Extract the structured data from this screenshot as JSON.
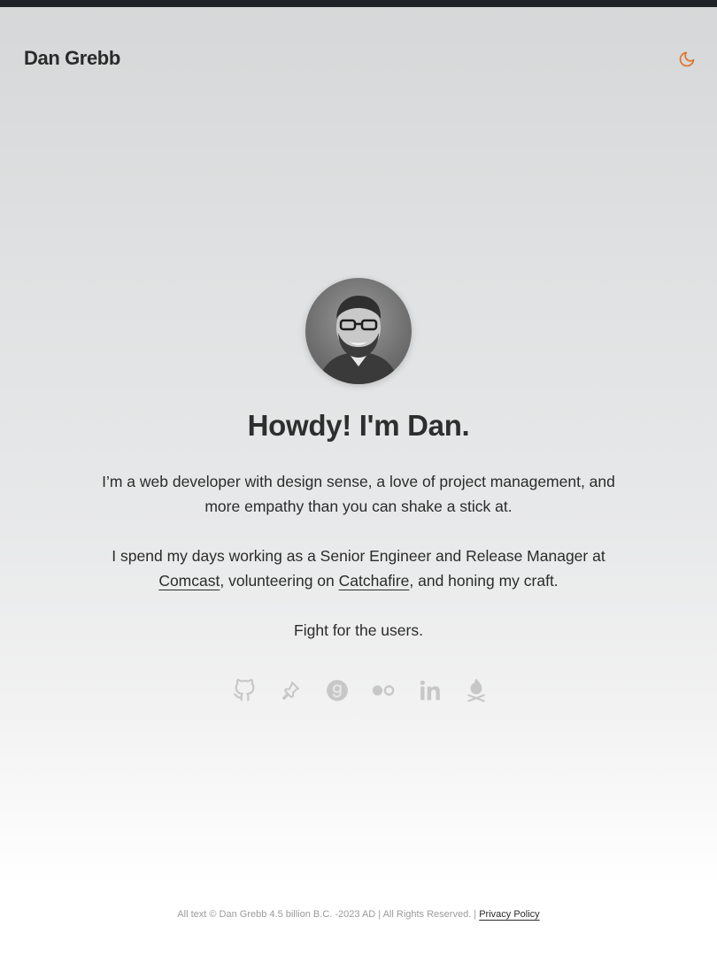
{
  "header": {
    "site_title": "Dan Grebb",
    "theme_toggle_icon": "moon-icon",
    "accent_color": "#e0722a"
  },
  "hero": {
    "avatar_alt": "Dan Grebb",
    "headline": "Howdy! I'm Dan.",
    "intro": "I’m a web developer with design sense, a love of project management, and more empathy than you can shake a stick at.",
    "work_prefix": "I spend my days working as a Senior Engineer and Release Manager at ",
    "work_link_1": "Comcast",
    "work_middle": ", volunteering on ",
    "work_link_2": "Catchafire",
    "work_suffix": ", and honing my craft.",
    "motto": "Fight for the users."
  },
  "socials": [
    {
      "icon": "github-icon"
    },
    {
      "icon": "pushpin-icon"
    },
    {
      "icon": "goodreads-icon"
    },
    {
      "icon": "flickr-icon"
    },
    {
      "icon": "linkedin-icon"
    },
    {
      "icon": "campfire-icon"
    }
  ],
  "footer": {
    "copyright": "All text © Dan Grebb 4.5 billion B.C. -2023 AD | All Rights Reserved. | ",
    "privacy_link": "Privacy Policy"
  }
}
